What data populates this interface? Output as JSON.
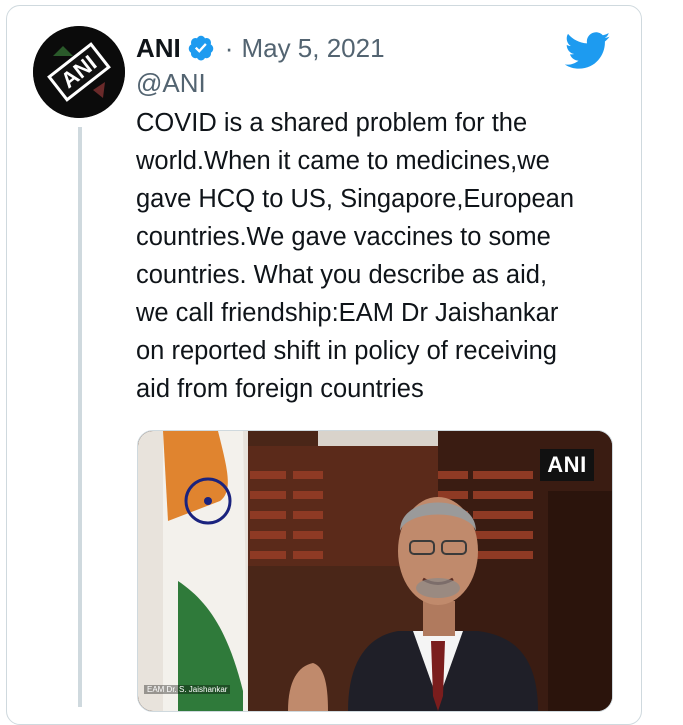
{
  "tweet": {
    "author_name": "ANI",
    "handle": "@ANI",
    "separator": "·",
    "date": "May 5, 2021",
    "text": "COVID is a shared problem for the\nworld.When it came to medicines,we\ngave HCQ to US, Singapore,European\ncountries.We gave vaccines to some\ncountries. What you describe as aid,\nwe call friendship:EAM Dr Jaishankar\non reported shift in policy of receiving\naid from foreign countries",
    "avatar_logo_text": "ANI",
    "verified_icon": "verified-badge-icon",
    "brand_icon": "twitter-bird-icon"
  },
  "media": {
    "logo_text": "ANI",
    "caption": "EAM Dr. S. Jaishankar"
  },
  "colors": {
    "accent": "#1d9bf0",
    "text": "#0f1419",
    "muted": "#536471",
    "border": "#cfd9de"
  }
}
